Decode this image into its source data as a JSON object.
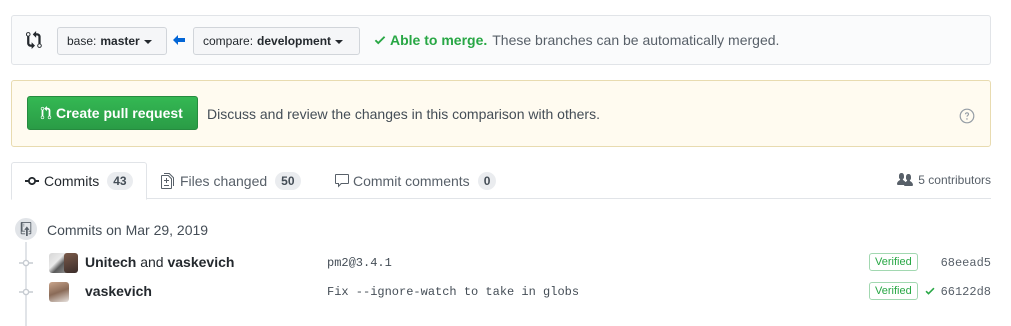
{
  "range": {
    "base_key": "base:",
    "base_value": "master",
    "compare_key": "compare:",
    "compare_value": "development",
    "merge_ok": "Able to merge.",
    "merge_text": "These branches can be automatically merged."
  },
  "pull_request": {
    "button_label": "Create pull request",
    "description": "Discuss and review the changes in this comparison with others."
  },
  "tabs": [
    {
      "label": "Commits",
      "count": "43"
    },
    {
      "label": "Files changed",
      "count": "50"
    },
    {
      "label": "Commit comments",
      "count": "0"
    }
  ],
  "contributors": "5 contributors",
  "commit_group": {
    "title": "Commits on Mar 29, 2019",
    "commits": [
      {
        "author1": "Unitech",
        "and": "and",
        "author2": "vaskevich",
        "message": "pm2@3.4.1",
        "verified": "Verified",
        "sha": "68eead5"
      },
      {
        "author1": "vaskevich",
        "message": "Fix --ignore-watch to take in globs",
        "verified": "Verified",
        "sha": "66122d8"
      }
    ]
  },
  "colors": {
    "success": "#28a745",
    "primary_button": "#2ea44f",
    "flash_background": "#fffbf0",
    "link_blue": "#0366d6"
  },
  "icons": [
    "git-compare-icon",
    "arrow-left-icon",
    "check-icon",
    "git-pull-request-icon",
    "question-icon",
    "git-commit-icon",
    "file-diff-icon",
    "comment-icon",
    "people-icon",
    "repo-push-icon"
  ]
}
